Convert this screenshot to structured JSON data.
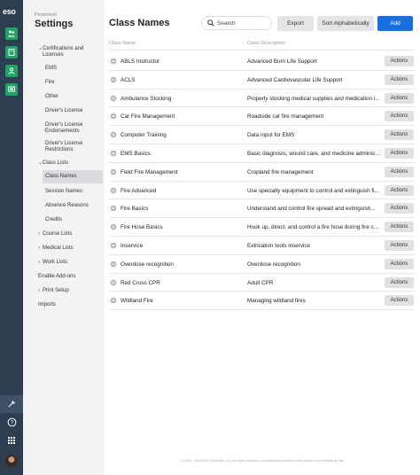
{
  "rail": {
    "logo": "eso",
    "apps": [
      "people-icon",
      "book-icon",
      "person-badge-icon",
      "monitor-icon"
    ],
    "bottom": [
      "wrench-icon",
      "help-icon",
      "apps-grid-icon",
      "avatar"
    ],
    "accent": "#21a366"
  },
  "settings": {
    "crumb": "Personnel",
    "title": "Settings",
    "nav": [
      {
        "label": "Certifications and Licenses",
        "type": "group",
        "expanded": true
      },
      {
        "label": "EMS",
        "type": "item"
      },
      {
        "label": "Fire",
        "type": "item"
      },
      {
        "label": "Other",
        "type": "item"
      },
      {
        "label": "Driver's License",
        "type": "item"
      },
      {
        "label": "Driver's License Endorsements",
        "type": "item"
      },
      {
        "label": "Driver's License Restrictions",
        "type": "item"
      },
      {
        "label": "Class Lists",
        "type": "group",
        "expanded": true
      },
      {
        "label": "Class Names",
        "type": "item",
        "selected": true
      },
      {
        "label": "Session Names",
        "type": "item"
      },
      {
        "label": "Absence Reasons",
        "type": "item"
      },
      {
        "label": "Credits",
        "type": "item"
      },
      {
        "label": "Course Lists",
        "type": "group",
        "expanded": false
      },
      {
        "label": "Medical Lists",
        "type": "group",
        "expanded": false
      },
      {
        "label": "Work Lists",
        "type": "group",
        "expanded": false
      },
      {
        "label": "Enable Add-ons",
        "type": "top"
      },
      {
        "label": "Print Setup",
        "type": "group",
        "expanded": false
      },
      {
        "label": "Imports",
        "type": "top"
      }
    ]
  },
  "main": {
    "title": "Class Names",
    "search_placeholder": "Search",
    "export_label": "Export",
    "sort_label": "Sort Alphabetically",
    "add_label": "Add",
    "col_name": "Class Name",
    "col_desc": "Class Description",
    "action_label": "Actions",
    "rows": [
      {
        "name": "ABLS Instructor",
        "desc": "Advanced Burn Life Support"
      },
      {
        "name": "ACLS",
        "desc": "Advanced Cardiovascular Life Support"
      },
      {
        "name": "Ambulance Stocking",
        "desc": "Properly stocking medical supplies and medication i..."
      },
      {
        "name": "Car Fire Management",
        "desc": "Roadside car fire management"
      },
      {
        "name": "Computer Training",
        "desc": "Data input for EMS"
      },
      {
        "name": "EMS Basics",
        "desc": "Basic diagnosis, wound care, and medicine administ..."
      },
      {
        "name": "Field Fire Management",
        "desc": "Cropland fire management"
      },
      {
        "name": "Fire Advanced",
        "desc": "Use specialty equipment to control and extinguish fi..."
      },
      {
        "name": "Fire Basics",
        "desc": "Understand and control fire spread and extinguish..."
      },
      {
        "name": "Fire Hose Basics",
        "desc": "Hook up, direct, and control a fire hose during fire c..."
      },
      {
        "name": "Inservice",
        "desc": "Extrication tools inservice"
      },
      {
        "name": "Overdose recognition",
        "desc": "Overdose recognition"
      },
      {
        "name": "Red Cross CPR",
        "desc": "Adult CPR"
      },
      {
        "name": "Wildland Fire",
        "desc": "Managing wildland fires"
      }
    ],
    "footer": "© 2016 - 2023 ESO Solutions, Inc. All rights reserved. Unauthorized access to this system is prohibited by law.",
    "add_color": "#1a6fe0"
  }
}
